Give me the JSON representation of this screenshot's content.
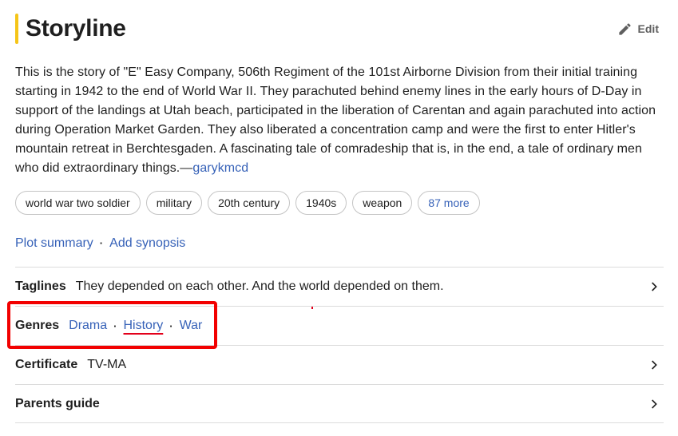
{
  "header": {
    "title": "Storyline",
    "edit_label": "Edit"
  },
  "plot": {
    "text": "This is the story of \"E\" Easy Company, 506th Regiment of the 101st Airborne Division from their initial training starting in 1942 to the end of World War II. They parachuted behind enemy lines in the early hours of D-Day in support of the landings at Utah beach, participated in the liberation of Carentan and again parachuted into action during Operation Market Garden. They also liberated a concentration camp and were the first to enter Hitler's mountain retreat in Berchtesgaden. A fascinating tale of comradeship that is, in the end, a tale of ordinary men who did extraordinary things.—",
    "author": "garykmcd"
  },
  "keywords": [
    "world war two soldier",
    "military",
    "20th century",
    "1940s",
    "weapon"
  ],
  "keywords_more": "87 more",
  "links": {
    "plot_summary": "Plot summary",
    "add_synopsis": "Add synopsis"
  },
  "taglines": {
    "label": "Taglines",
    "value": "They depended on each other. And the world depended on them."
  },
  "genres": {
    "label": "Genres",
    "items": [
      "Drama",
      "History",
      "War"
    ]
  },
  "certificate": {
    "label": "Certificate",
    "value": "TV-MA"
  },
  "parents_guide": {
    "label": "Parents guide"
  },
  "colors": {
    "accent_yellow": "#f5c518",
    "link_blue": "#3762b8",
    "highlight_red": "#f20000"
  },
  "icons": {
    "edit": "pencil-icon",
    "row_arrow": "chevron-right-icon"
  }
}
